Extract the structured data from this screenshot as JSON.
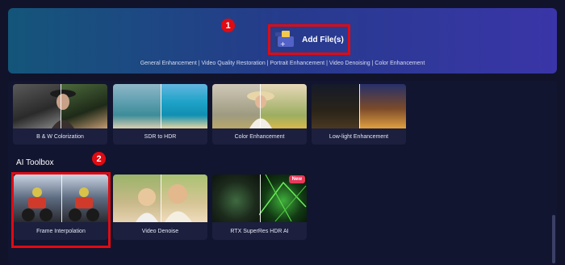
{
  "header": {
    "add_files_label": "Add File(s)",
    "features": "General Enhancement | Video Quality Restoration | Portrait Enhancement | Video Denoising | Color Enhancement"
  },
  "markers": {
    "one": "1",
    "two": "2"
  },
  "enhancements": [
    {
      "label": "B & W Colorization"
    },
    {
      "label": "SDR to HDR"
    },
    {
      "label": "Color Enhancement"
    },
    {
      "label": "Low-light Enhancement"
    }
  ],
  "toolbox": {
    "title": "AI Toolbox",
    "items": [
      {
        "label": "Frame Interpolation"
      },
      {
        "label": "Video Denoise"
      },
      {
        "label": "RTX SuperRes HDR AI",
        "badge": "New"
      }
    ]
  },
  "colors": {
    "highlight": "#e00a12",
    "badge": "#e8385a"
  }
}
